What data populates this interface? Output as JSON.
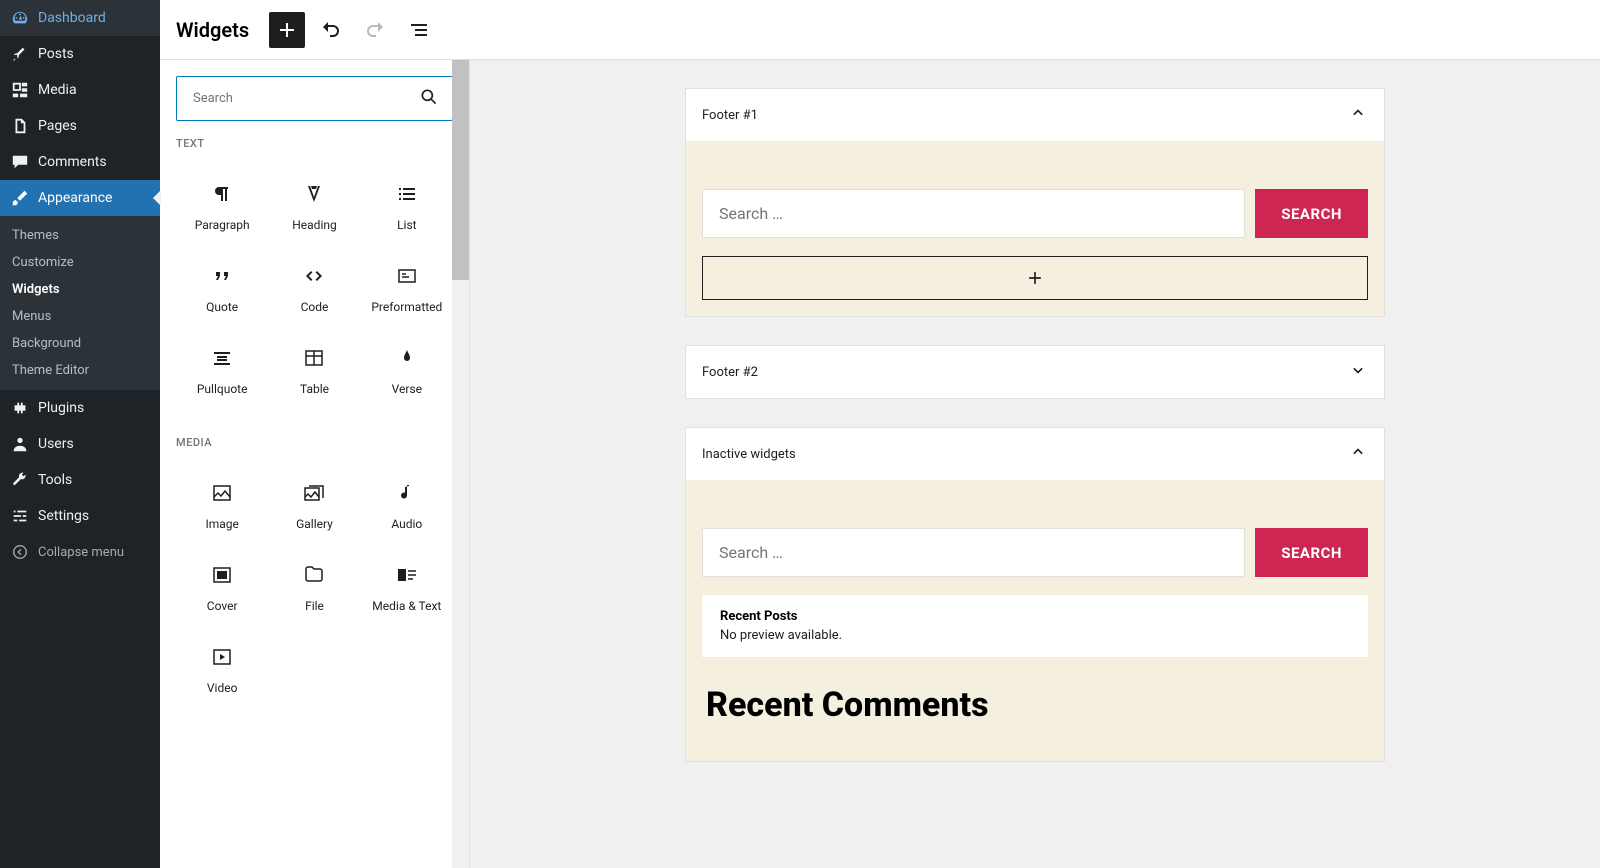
{
  "adminMenu": {
    "dashboard": "Dashboard",
    "posts": "Posts",
    "media": "Media",
    "pages": "Pages",
    "comments": "Comments",
    "appearance": "Appearance",
    "plugins": "Plugins",
    "users": "Users",
    "tools": "Tools",
    "settings": "Settings",
    "collapse": "Collapse menu"
  },
  "appearanceSubmenu": {
    "themes": "Themes",
    "customize": "Customize",
    "widgets": "Widgets",
    "menus": "Menus",
    "background": "Background",
    "themeEditor": "Theme Editor"
  },
  "toolbar": {
    "title": "Widgets"
  },
  "inserter": {
    "searchPlaceholder": "Search",
    "categories": {
      "text": "TEXT",
      "media": "MEDIA"
    },
    "blocks": {
      "paragraph": "Paragraph",
      "heading": "Heading",
      "list": "List",
      "quote": "Quote",
      "code": "Code",
      "preformatted": "Preformatted",
      "pullquote": "Pullquote",
      "table": "Table",
      "verse": "Verse",
      "image": "Image",
      "gallery": "Gallery",
      "audio": "Audio",
      "cover": "Cover",
      "file": "File",
      "mediaText": "Media & Text",
      "video": "Video"
    }
  },
  "widgetAreas": {
    "footer1": {
      "title": "Footer #1",
      "searchPlaceholder": "Search …",
      "searchButton": "SEARCH"
    },
    "footer2": {
      "title": "Footer #2"
    },
    "inactive": {
      "title": "Inactive widgets",
      "searchPlaceholder": "Search …",
      "searchButton": "SEARCH",
      "recentPosts": {
        "title": "Recent Posts",
        "noPreview": "No preview available."
      },
      "recentCommentsHeading": "Recent Comments"
    }
  }
}
